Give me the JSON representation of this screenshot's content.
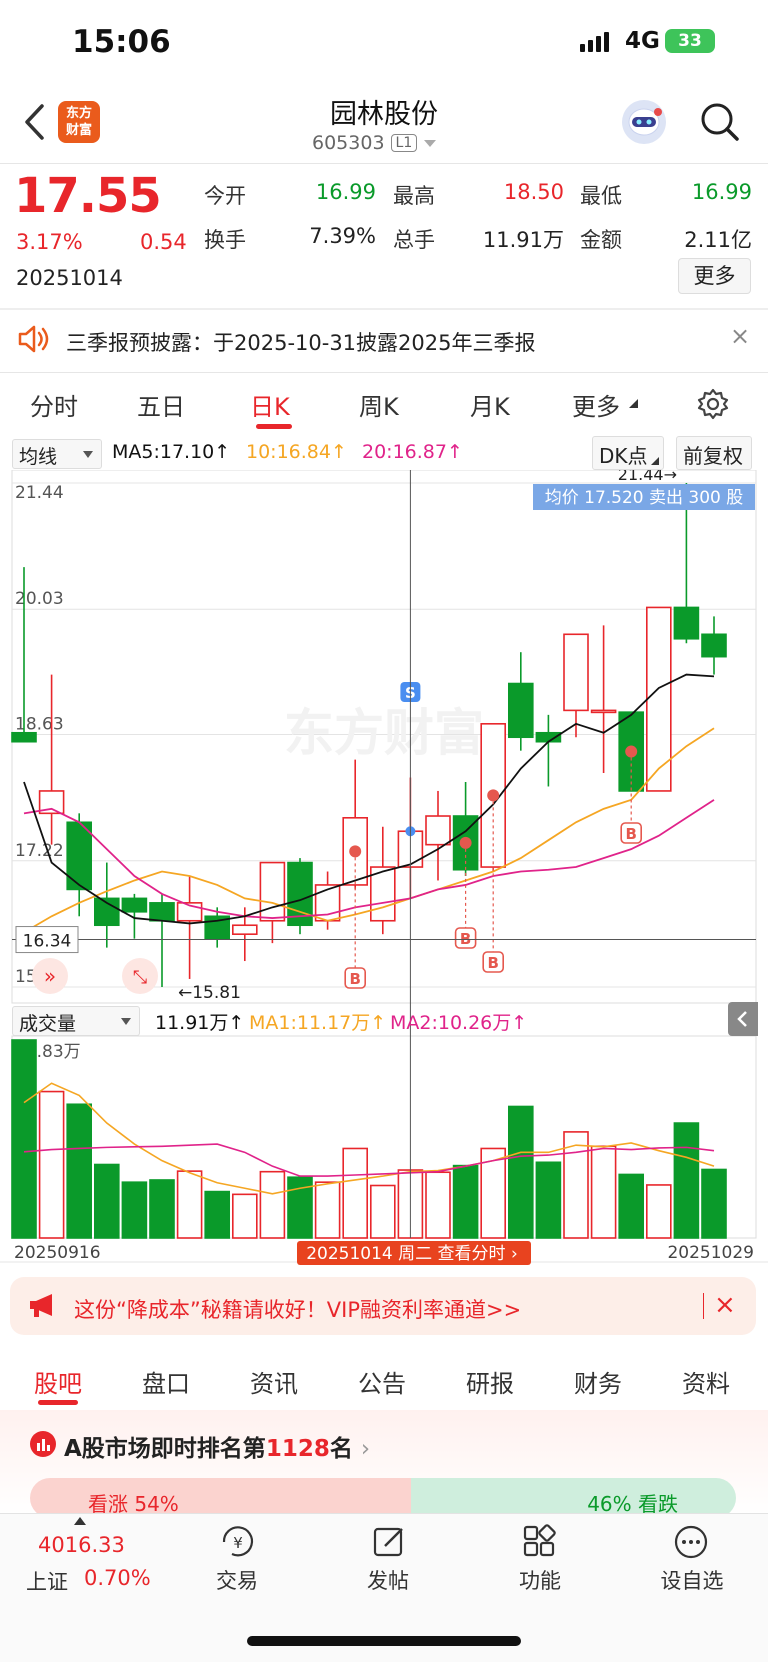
{
  "status_bar": {
    "time": "15:06",
    "network": "4G",
    "battery": "33"
  },
  "header": {
    "logo_text_1": "东方",
    "logo_text_2": "财富",
    "title": "园林股份",
    "code": "605303",
    "level": "L1"
  },
  "quote": {
    "price": "17.55",
    "change_pct": "3.17%",
    "change": "0.54",
    "date": "20251014",
    "fields": [
      {
        "label": "今开",
        "value": "16.99",
        "color": "#0a9a2a"
      },
      {
        "label": "最高",
        "value": "18.50",
        "color": "#e8262b"
      },
      {
        "label": "最低",
        "value": "16.99",
        "color": "#0a9a2a"
      },
      {
        "label": "换手",
        "value": "7.39%",
        "color": "#222222"
      },
      {
        "label": "总手",
        "value": "11.91万",
        "color": "#222222"
      },
      {
        "label": "金额",
        "value": "2.11亿",
        "color": "#222222"
      }
    ],
    "more": "更多"
  },
  "notice": {
    "text": "三季报预披露：于2025-10-31披露2025年三季报",
    "close": "×"
  },
  "chart_tabs": [
    "分时",
    "五日",
    "日K",
    "周K",
    "月K",
    "更多"
  ],
  "ma_row": {
    "selector": "均线",
    "ma5": "MA5:17.10↑",
    "ma10": "10:16.84↑",
    "ma20": "20:16.87↑",
    "dk": "DK点",
    "adjust": "前复权"
  },
  "vol_row": {
    "selector": "成交量",
    "vol": "11.91万↑",
    "ma1": "MA1:11.17万↑",
    "ma2": "MA2:10.26万↑"
  },
  "chart_data": {
    "type": "candlestick",
    "price_axis_labels": [
      "21.44",
      "20.03",
      "18.63",
      "17.22",
      "15.81"
    ],
    "ylim": [
      15.81,
      21.44
    ],
    "crosshair_price": "16.34",
    "avg_tooltip": "均价 17.520 卖出 300 股",
    "max_marker": "21.44→",
    "min_marker": "←15.81",
    "volume_axis_label": "35.83万",
    "x_start": "20250916",
    "x_end": "20251029",
    "date_pill": "20251014 周二 查看分时",
    "candles": [
      {
        "o": 18.65,
        "h": 20.5,
        "l": 18.55,
        "c": 18.55
      },
      {
        "o": 17.75,
        "h": 19.3,
        "l": 17.4,
        "c": 18.0
      },
      {
        "o": 17.65,
        "h": 17.75,
        "l": 16.6,
        "c": 16.9
      },
      {
        "o": 16.8,
        "h": 17.2,
        "l": 16.25,
        "c": 16.5
      },
      {
        "o": 16.8,
        "h": 16.85,
        "l": 16.35,
        "c": 16.65
      },
      {
        "o": 16.75,
        "h": 16.85,
        "l": 15.81,
        "c": 16.55
      },
      {
        "o": 16.55,
        "h": 17.05,
        "l": 15.9,
        "c": 16.75
      },
      {
        "o": 16.6,
        "h": 16.7,
        "l": 16.25,
        "c": 16.35
      },
      {
        "o": 16.4,
        "h": 16.7,
        "l": 16.1,
        "c": 16.5
      },
      {
        "o": 16.55,
        "h": 17.15,
        "l": 16.3,
        "c": 17.2
      },
      {
        "o": 17.2,
        "h": 17.25,
        "l": 16.4,
        "c": 16.5
      },
      {
        "o": 16.55,
        "h": 17.1,
        "l": 16.45,
        "c": 16.95
      },
      {
        "o": 16.95,
        "h": 18.35,
        "l": 16.9,
        "c": 17.7
      },
      {
        "o": 16.55,
        "h": 17.6,
        "l": 16.4,
        "c": 17.15
      },
      {
        "o": 17.15,
        "h": 18.15,
        "l": 16.8,
        "c": 17.55
      },
      {
        "o": 17.4,
        "h": 18.0,
        "l": 17.0,
        "c": 17.72
      },
      {
        "o": 17.72,
        "h": 18.1,
        "l": 17.05,
        "c": 17.12
      },
      {
        "o": 17.15,
        "h": 18.75,
        "l": 17.1,
        "c": 18.75
      },
      {
        "o": 19.2,
        "h": 19.55,
        "l": 18.45,
        "c": 18.6
      },
      {
        "o": 18.65,
        "h": 18.85,
        "l": 18.05,
        "c": 18.55
      },
      {
        "o": 18.9,
        "h": 19.65,
        "l": 18.6,
        "c": 19.75
      },
      {
        "o": 18.9,
        "h": 19.85,
        "l": 18.2,
        "c": 18.9
      },
      {
        "o": 18.88,
        "h": 18.88,
        "l": 18.0,
        "c": 18.0
      },
      {
        "o": 18.0,
        "h": 20.05,
        "l": 18.0,
        "c": 20.05
      },
      {
        "o": 20.05,
        "h": 21.44,
        "l": 19.65,
        "c": 19.7
      },
      {
        "o": 19.75,
        "h": 19.95,
        "l": 19.3,
        "c": 19.5
      }
    ],
    "ma5": [
      18.1,
      17.2,
      16.95,
      16.75,
      16.58,
      16.55,
      16.52,
      16.55,
      16.6,
      16.7,
      16.78,
      16.9,
      17.0,
      17.1,
      17.18,
      17.35,
      17.55,
      17.85,
      18.25,
      18.55,
      18.75,
      18.65,
      18.85,
      19.15,
      19.3,
      19.28
    ],
    "ma10": [
      16.42,
      16.6,
      16.75,
      16.88,
      17.0,
      17.1,
      17.05,
      16.95,
      16.8,
      16.75,
      16.65,
      16.55,
      16.62,
      16.7,
      16.8,
      16.9,
      17.0,
      17.1,
      17.25,
      17.45,
      17.65,
      17.8,
      17.9,
      18.25,
      18.5,
      18.7
    ],
    "ma20": [
      17.75,
      17.8,
      17.65,
      17.35,
      17.05,
      16.85,
      16.72,
      16.65,
      16.6,
      16.58,
      16.6,
      16.62,
      16.7,
      16.75,
      16.8,
      16.9,
      16.95,
      17.05,
      17.1,
      17.12,
      17.15,
      17.25,
      17.35,
      17.5,
      17.7,
      17.9
    ],
    "volume": [
      35.83,
      26.5,
      24.2,
      13.3,
      10.1,
      10.5,
      12.1,
      8.4,
      7.9,
      12.0,
      11.0,
      10.1,
      16.2,
      9.5,
      12.3,
      11.9,
      13.1,
      16.2,
      23.8,
      13.7,
      19.2,
      16.6,
      11.5,
      9.6,
      20.8,
      12.4
    ],
    "vol_ma1": [
      24.5,
      28.0,
      25.8,
      20.8,
      17.0,
      14.0,
      11.8,
      10.0,
      9.0,
      8.0,
      9.0,
      9.8,
      10.5,
      11.2,
      12.0,
      12.2,
      13.0,
      14.0,
      15.5,
      15.5,
      16.8,
      16.5,
      17.2,
      15.8,
      14.6,
      13.0
    ],
    "vol_ma2": [
      15.6,
      16.0,
      16.2,
      16.4,
      16.5,
      16.6,
      16.8,
      17.0,
      15.5,
      13.0,
      11.2,
      11.2,
      11.4,
      11.6,
      11.8,
      12.0,
      13.0,
      14.0,
      14.8,
      15.0,
      15.5,
      16.2,
      16.0,
      16.3,
      16.4,
      15.8
    ],
    "b_markers": [
      12,
      16,
      17,
      22
    ],
    "s_marker": 14,
    "crosshair_index": 14,
    "colors": {
      "up": "#e8262b",
      "down": "#0a9a2a",
      "ma5": "#111111",
      "ma10": "#f5a623",
      "ma20": "#e0238a"
    }
  },
  "promo": {
    "text": "这份“降成本”秘籍请收好！VIP融资利率通道>>",
    "close": "×"
  },
  "bottom_tabs": [
    "股吧",
    "盘口",
    "资讯",
    "公告",
    "研报",
    "财务",
    "资料"
  ],
  "rank": {
    "prefix": "A股市场即时排名第",
    "rank": "1128",
    "suffix": "名",
    "up_label": "看涨 54%",
    "down_label": "46% 看跌"
  },
  "bottom_nav": {
    "index_value": "4016.33",
    "index_name": "上证",
    "index_pct": "0.70%",
    "items": [
      "交易",
      "发帖",
      "功能",
      "设自选"
    ]
  }
}
